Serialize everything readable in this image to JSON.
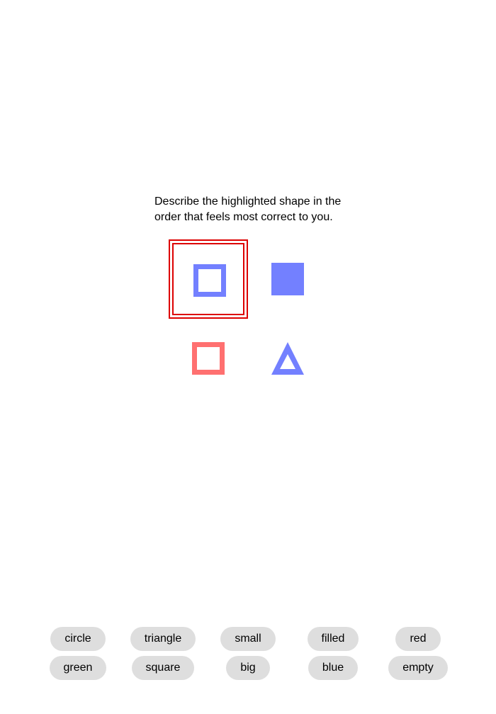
{
  "instructions": "Describe the highlighted shape in the order that feels most correct to you.",
  "shapes": [
    {
      "shape": "square",
      "fill": "empty",
      "color": "#7380ff",
      "highlighted": true
    },
    {
      "shape": "square",
      "fill": "filled",
      "color": "#7380ff",
      "highlighted": false
    },
    {
      "shape": "square",
      "fill": "empty",
      "color": "#ff7070",
      "highlighted": false
    },
    {
      "shape": "triangle",
      "fill": "empty",
      "color": "#7380ff",
      "highlighted": false
    }
  ],
  "word_rows": [
    [
      "circle",
      "triangle",
      "small",
      "filled",
      "red"
    ],
    [
      "green",
      "square",
      "big",
      "blue",
      "empty"
    ]
  ],
  "colors": {
    "highlight": "#dd0000",
    "word_button_bg": "#dedede"
  }
}
